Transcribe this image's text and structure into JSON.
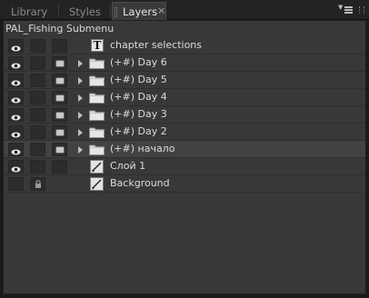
{
  "tabs": [
    {
      "label": "Library",
      "active": false
    },
    {
      "label": "Styles",
      "active": false
    },
    {
      "label": "Layers",
      "active": true
    }
  ],
  "close_glyph": "×",
  "composition_title": "PAL_Fishing Submenu",
  "layers": [
    {
      "name": "chapter selections",
      "kind": "text",
      "visible": true,
      "locked": false,
      "has_outline": false,
      "expandable": false
    },
    {
      "name": "(+#) Day 6",
      "kind": "group",
      "visible": true,
      "locked": false,
      "has_outline": true,
      "expandable": true
    },
    {
      "name": "(+#) Day 5",
      "kind": "group",
      "visible": true,
      "locked": false,
      "has_outline": true,
      "expandable": true
    },
    {
      "name": "(+#) Day 4",
      "kind": "group",
      "visible": true,
      "locked": false,
      "has_outline": true,
      "expandable": true
    },
    {
      "name": "(+#) Day 3",
      "kind": "group",
      "visible": true,
      "locked": false,
      "has_outline": true,
      "expandable": true
    },
    {
      "name": "(+#) Day 2",
      "kind": "group",
      "visible": true,
      "locked": false,
      "has_outline": true,
      "expandable": true
    },
    {
      "name": "(+#) начало",
      "kind": "group",
      "visible": true,
      "locked": false,
      "has_outline": true,
      "expandable": true,
      "highlighted": true
    },
    {
      "name": "Слой 1",
      "kind": "drawing",
      "visible": true,
      "locked": false,
      "has_outline": false,
      "expandable": false
    },
    {
      "name": "Background",
      "kind": "drawing",
      "visible": false,
      "locked": true,
      "has_outline": false,
      "expandable": false
    }
  ],
  "icons": {
    "visibility": "eye-icon",
    "lock": "lock-icon",
    "group": "folder-icon",
    "text_layer": "text-layer-icon",
    "drawing_layer": "brush-layer-icon",
    "expand": "expand-triangle-icon",
    "panel_menu": "panel-menu-icon"
  },
  "colors": {
    "panel_bg": "#383838",
    "tab_active_bg": "#3a3a3a",
    "highlight_row": "#424242",
    "text": "#dcdcdc"
  }
}
